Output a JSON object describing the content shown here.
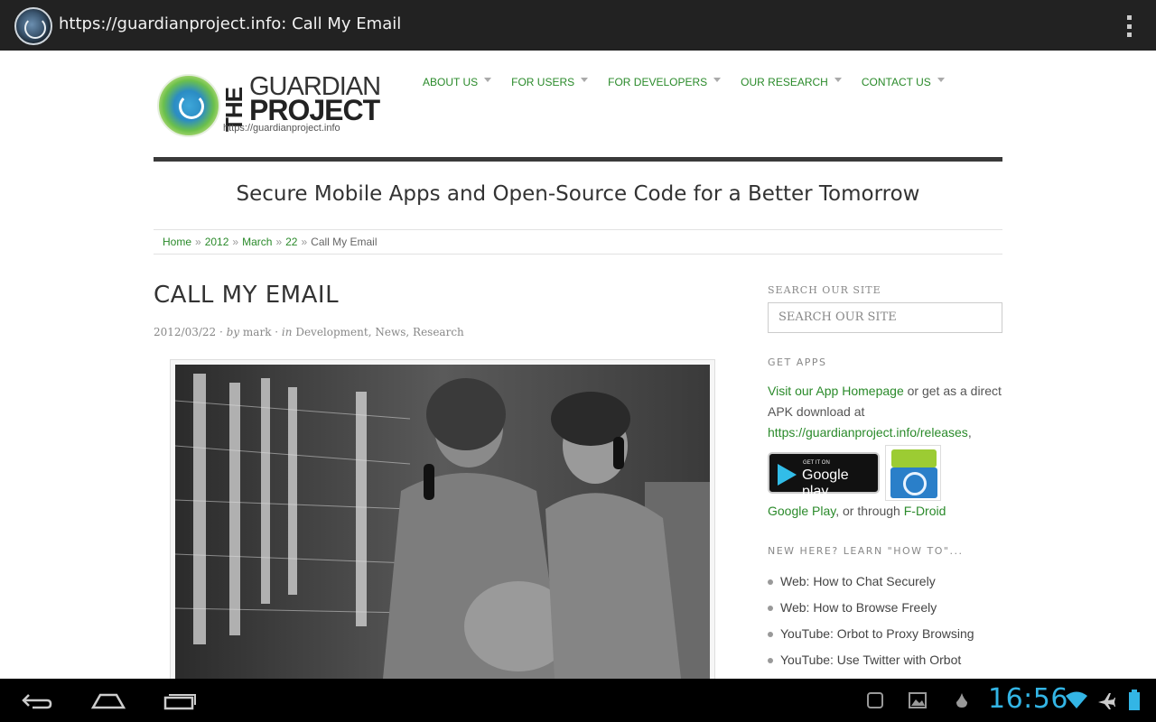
{
  "browser": {
    "title": "https://guardianproject.info: Call My Email"
  },
  "site": {
    "logo": {
      "the": "THE",
      "guardian": "GUARDIAN",
      "project": "PROJECT",
      "url": "https://guardianproject.info"
    },
    "nav": [
      "About Us",
      "For Users",
      "For Developers",
      "Our Research",
      "Contact Us"
    ],
    "tagline": "Secure Mobile Apps and Open-Source Code for a Better Tomorrow",
    "breadcrumb": {
      "home": "Home",
      "year": "2012",
      "month": "March",
      "day": "22",
      "current": "Call My Email",
      "separator": "»"
    }
  },
  "post": {
    "title": "CALL MY EMAIL",
    "date": "2012/03/22",
    "by_label": "by",
    "author": "mark",
    "in_label": "in",
    "categories": [
      "Development",
      "News",
      "Research"
    ]
  },
  "sidebar": {
    "search_heading": "Search Our Site",
    "search_placeholder": "SEARCH OUR SITE",
    "apps_heading": "GET APPS",
    "apps_link": "Visit our App Homepage",
    "apps_text_1": " or get as a direct APK download at ",
    "apps_url": "https://guardianproject.info/releases",
    "apps_text_2": ",",
    "gplay_get": "GET IT ON",
    "gplay_name": "Google play",
    "gplay_link": "Google Play",
    "through_text": ", or through ",
    "fdroid_link": "F-Droid",
    "howto_heading": "NEW HERE? LEARN \"HOW TO\"...",
    "howto": [
      "Web: How to Chat Securely",
      "Web: How to Browse Freely",
      "YouTube: Orbot to Proxy Browsing",
      "YouTube: Use Twitter with Orbot"
    ]
  },
  "system": {
    "clock": "16:56",
    "icons": [
      "back-icon",
      "home-icon",
      "recent-apps-icon",
      "screenshot-icon",
      "gallery-icon",
      "drop-icon",
      "wifi-icon",
      "airplane-icon",
      "battery-icon"
    ],
    "accent": "#33b5e5"
  },
  "colors": {
    "link": "#2a8a2a",
    "titlebar": "#222222"
  }
}
